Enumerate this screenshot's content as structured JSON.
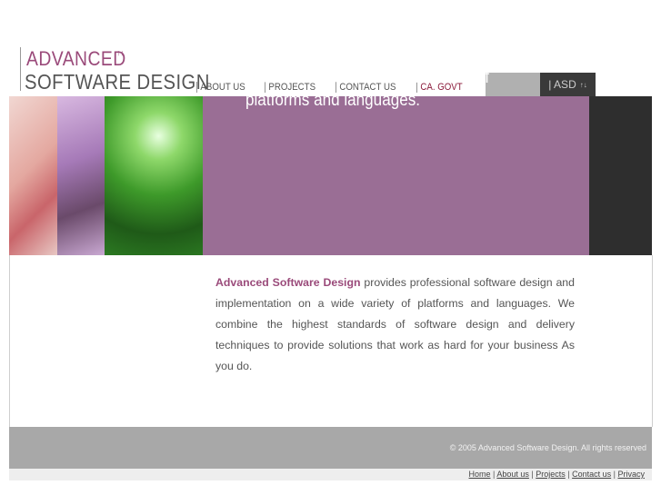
{
  "logo": {
    "line1": "ADVANCED",
    "line2": "SOFTWARE DESIGN",
    "arrows": "↑↓"
  },
  "nav": [
    {
      "label": "ABOUT US"
    },
    {
      "label": "PROJECTS"
    },
    {
      "label": "CONTACT US"
    },
    {
      "label": "CA. GOVT"
    }
  ],
  "tab": {
    "label": "| ASD",
    "arrows": "↑↓"
  },
  "banner": {
    "tagline": "professional software design and implementation on a wide variety of platforms and languages."
  },
  "content": {
    "brand": "Advanced Software Design",
    "text": " provides professional software design and implementation on a wide variety of platforms and languages. We combine the highest standards of software design and delivery techniques to provide solutions that work as hard for your business As you do."
  },
  "footer": {
    "copyright": "© 2005 Advanced Software Design. All rights reserved",
    "links": [
      "Home",
      "About us",
      "Projects",
      "Contact us",
      "Privacy"
    ],
    "separator": " | "
  },
  "colors": {
    "purple": "#9a6e95",
    "brand": "#9a4a7a",
    "dark": "#2e2e2e",
    "footer": "#a8a8a8"
  }
}
